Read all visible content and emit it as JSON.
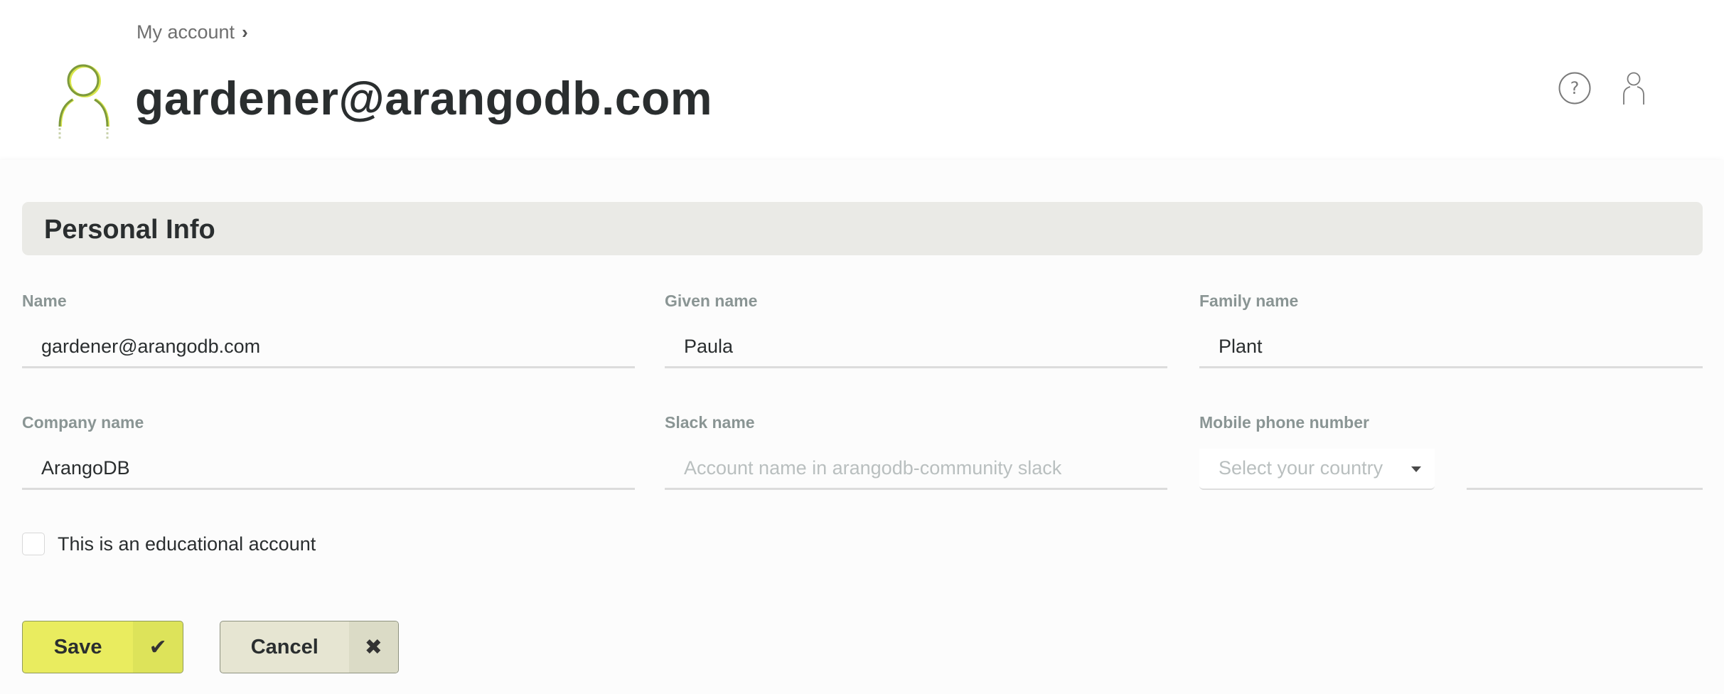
{
  "breadcrumb": {
    "label": "My account",
    "separator": "›"
  },
  "header": {
    "title": "gardener@arangodb.com",
    "avatar_icon": "user-avatar-icon",
    "help_icon": "help-circle-icon",
    "user_icon": "user-icon"
  },
  "section": {
    "title": "Personal Info"
  },
  "fields": {
    "name": {
      "label": "Name",
      "value": "gardener@arangodb.com",
      "placeholder": ""
    },
    "given_name": {
      "label": "Given name",
      "value": "Paula",
      "placeholder": ""
    },
    "family_name": {
      "label": "Family name",
      "value": "Plant",
      "placeholder": ""
    },
    "company_name": {
      "label": "Company name",
      "value": "ArangoDB",
      "placeholder": ""
    },
    "slack_name": {
      "label": "Slack name",
      "value": "",
      "placeholder": "Account name in arangodb-community slack"
    },
    "mobile_phone": {
      "label": "Mobile phone number",
      "country_placeholder": "Select your country",
      "value": ""
    }
  },
  "educational": {
    "label": "This is an educational account",
    "checked": false
  },
  "actions": {
    "save_label": "Save",
    "save_icon": "✔",
    "cancel_label": "Cancel",
    "cancel_icon": "✖"
  },
  "colors": {
    "accent": "#e9ec5f",
    "accent_dark": "#7d9a3c",
    "section_bg": "#eaeae6",
    "label": "#8a9594"
  }
}
